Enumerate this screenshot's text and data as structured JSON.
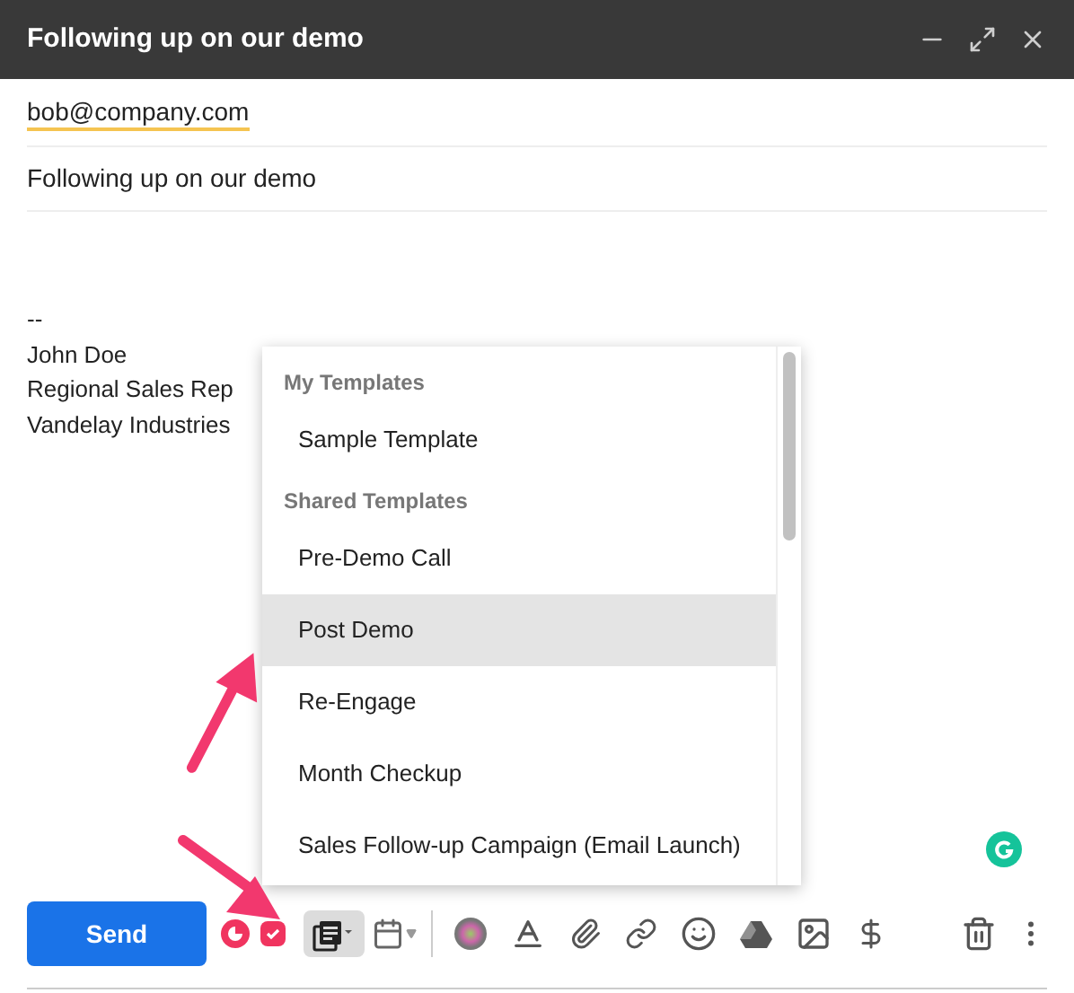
{
  "window": {
    "title": "Following up on our demo"
  },
  "to": {
    "value": "bob@company.com"
  },
  "subject": {
    "value": "Following up on our demo"
  },
  "signature": [
    "--",
    "John Doe",
    "Regional Sales Rep",
    "Vandelay Industries"
  ],
  "templates_menu": [
    {
      "kind": "header",
      "label": "My Templates"
    },
    {
      "kind": "item",
      "label": "Sample Template",
      "selected": false
    },
    {
      "kind": "header",
      "label": "Shared Templates"
    },
    {
      "kind": "item",
      "label": "Pre-Demo Call",
      "selected": false
    },
    {
      "kind": "item",
      "label": "Post Demo",
      "selected": true
    },
    {
      "kind": "item",
      "label": "Re-Engage",
      "selected": false
    },
    {
      "kind": "item",
      "label": "Month Checkup",
      "selected": false
    },
    {
      "kind": "item",
      "label": "Sales Follow-up Campaign (Email Launch)",
      "selected": false
    }
  ],
  "send_button": "Send"
}
